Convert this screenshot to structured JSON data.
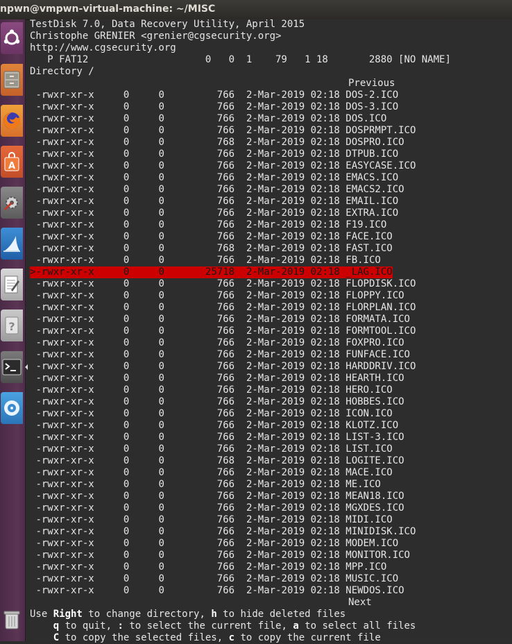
{
  "window": {
    "title": "npwn@vmpwn-virtual-machine: ~/MISC"
  },
  "launcher": {
    "items": [
      {
        "name": "ubuntu-dash"
      },
      {
        "name": "files"
      },
      {
        "name": "firefox"
      },
      {
        "name": "software-center"
      },
      {
        "name": "system-settings"
      },
      {
        "name": "wireshark"
      },
      {
        "name": "text-editor"
      },
      {
        "name": "help"
      },
      {
        "name": "terminal"
      },
      {
        "name": "disk-utility"
      },
      {
        "name": "trash"
      }
    ]
  },
  "terminal": {
    "header": [
      "TestDisk 7.0, Data Recovery Utility, April 2015",
      "Christophe GRENIER <grenier@cgsecurity.org>",
      "http://www.cgsecurity.org",
      "   P FAT12                    0   0  1    79   1 18       2880 [NO NAME]",
      "Directory /"
    ],
    "previous_label": "Previous",
    "next_label": "Next",
    "cursor_marker": ">",
    "files": [
      {
        "perm": "-rwxr-xr-x",
        "uid": "0",
        "gid": "0",
        "size": "766",
        "date": "2-Mar-2019",
        "time": "02:18",
        "name": "DOS-2.ICO"
      },
      {
        "perm": "-rwxr-xr-x",
        "uid": "0",
        "gid": "0",
        "size": "766",
        "date": "2-Mar-2019",
        "time": "02:18",
        "name": "DOS-3.ICO"
      },
      {
        "perm": "-rwxr-xr-x",
        "uid": "0",
        "gid": "0",
        "size": "766",
        "date": "2-Mar-2019",
        "time": "02:18",
        "name": "DOS.ICO"
      },
      {
        "perm": "-rwxr-xr-x",
        "uid": "0",
        "gid": "0",
        "size": "766",
        "date": "2-Mar-2019",
        "time": "02:18",
        "name": "DOSPRMPT.ICO"
      },
      {
        "perm": "-rwxr-xr-x",
        "uid": "0",
        "gid": "0",
        "size": "768",
        "date": "2-Mar-2019",
        "time": "02:18",
        "name": "DOSPRO.ICO"
      },
      {
        "perm": "-rwxr-xr-x",
        "uid": "0",
        "gid": "0",
        "size": "766",
        "date": "2-Mar-2019",
        "time": "02:18",
        "name": "DTPUB.ICO"
      },
      {
        "perm": "-rwxr-xr-x",
        "uid": "0",
        "gid": "0",
        "size": "766",
        "date": "2-Mar-2019",
        "time": "02:18",
        "name": "EASYCASE.ICO"
      },
      {
        "perm": "-rwxr-xr-x",
        "uid": "0",
        "gid": "0",
        "size": "766",
        "date": "2-Mar-2019",
        "time": "02:18",
        "name": "EMACS.ICO"
      },
      {
        "perm": "-rwxr-xr-x",
        "uid": "0",
        "gid": "0",
        "size": "766",
        "date": "2-Mar-2019",
        "time": "02:18",
        "name": "EMACS2.ICO"
      },
      {
        "perm": "-rwxr-xr-x",
        "uid": "0",
        "gid": "0",
        "size": "766",
        "date": "2-Mar-2019",
        "time": "02:18",
        "name": "EMAIL.ICO"
      },
      {
        "perm": "-rwxr-xr-x",
        "uid": "0",
        "gid": "0",
        "size": "766",
        "date": "2-Mar-2019",
        "time": "02:18",
        "name": "EXTRA.ICO"
      },
      {
        "perm": "-rwxr-xr-x",
        "uid": "0",
        "gid": "0",
        "size": "766",
        "date": "2-Mar-2019",
        "time": "02:18",
        "name": "F19.ICO"
      },
      {
        "perm": "-rwxr-xr-x",
        "uid": "0",
        "gid": "0",
        "size": "766",
        "date": "2-Mar-2019",
        "time": "02:18",
        "name": "FACE.ICO"
      },
      {
        "perm": "-rwxr-xr-x",
        "uid": "0",
        "gid": "0",
        "size": "768",
        "date": "2-Mar-2019",
        "time": "02:18",
        "name": "FAST.ICO"
      },
      {
        "perm": "-rwxr-xr-x",
        "uid": "0",
        "gid": "0",
        "size": "766",
        "date": "2-Mar-2019",
        "time": "02:18",
        "name": "FB.ICO"
      },
      {
        "perm": "-rwxr-xr-x",
        "uid": "0",
        "gid": "0",
        "size": "25718",
        "date": "2-Mar-2019",
        "time": "02:18",
        "name": "_LAG.ICO",
        "selected": true
      },
      {
        "perm": "-rwxr-xr-x",
        "uid": "0",
        "gid": "0",
        "size": "766",
        "date": "2-Mar-2019",
        "time": "02:18",
        "name": "FLOPDISK.ICO"
      },
      {
        "perm": "-rwxr-xr-x",
        "uid": "0",
        "gid": "0",
        "size": "766",
        "date": "2-Mar-2019",
        "time": "02:18",
        "name": "FLOPPY.ICO"
      },
      {
        "perm": "-rwxr-xr-x",
        "uid": "0",
        "gid": "0",
        "size": "766",
        "date": "2-Mar-2019",
        "time": "02:18",
        "name": "FLORPLAN.ICO"
      },
      {
        "perm": "-rwxr-xr-x",
        "uid": "0",
        "gid": "0",
        "size": "766",
        "date": "2-Mar-2019",
        "time": "02:18",
        "name": "FORMATA.ICO"
      },
      {
        "perm": "-rwxr-xr-x",
        "uid": "0",
        "gid": "0",
        "size": "766",
        "date": "2-Mar-2019",
        "time": "02:18",
        "name": "FORMTOOL.ICO"
      },
      {
        "perm": "-rwxr-xr-x",
        "uid": "0",
        "gid": "0",
        "size": "766",
        "date": "2-Mar-2019",
        "time": "02:18",
        "name": "FOXPRO.ICO"
      },
      {
        "perm": "-rwxr-xr-x",
        "uid": "0",
        "gid": "0",
        "size": "766",
        "date": "2-Mar-2019",
        "time": "02:18",
        "name": "FUNFACE.ICO"
      },
      {
        "perm": "-rwxr-xr-x",
        "uid": "0",
        "gid": "0",
        "size": "766",
        "date": "2-Mar-2019",
        "time": "02:18",
        "name": "HARDDRIV.ICO"
      },
      {
        "perm": "-rwxr-xr-x",
        "uid": "0",
        "gid": "0",
        "size": "766",
        "date": "2-Mar-2019",
        "time": "02:18",
        "name": "HEARTH.ICO"
      },
      {
        "perm": "-rwxr-xr-x",
        "uid": "0",
        "gid": "0",
        "size": "766",
        "date": "2-Mar-2019",
        "time": "02:18",
        "name": "HERO.ICO"
      },
      {
        "perm": "-rwxr-xr-x",
        "uid": "0",
        "gid": "0",
        "size": "766",
        "date": "2-Mar-2019",
        "time": "02:18",
        "name": "HOBBES.ICO"
      },
      {
        "perm": "-rwxr-xr-x",
        "uid": "0",
        "gid": "0",
        "size": "766",
        "date": "2-Mar-2019",
        "time": "02:18",
        "name": "ICON.ICO"
      },
      {
        "perm": "-rwxr-xr-x",
        "uid": "0",
        "gid": "0",
        "size": "766",
        "date": "2-Mar-2019",
        "time": "02:18",
        "name": "KLOTZ.ICO"
      },
      {
        "perm": "-rwxr-xr-x",
        "uid": "0",
        "gid": "0",
        "size": "766",
        "date": "2-Mar-2019",
        "time": "02:18",
        "name": "LIST-3.ICO"
      },
      {
        "perm": "-rwxr-xr-x",
        "uid": "0",
        "gid": "0",
        "size": "766",
        "date": "2-Mar-2019",
        "time": "02:18",
        "name": "LIST.ICO"
      },
      {
        "perm": "-rwxr-xr-x",
        "uid": "0",
        "gid": "0",
        "size": "768",
        "date": "2-Mar-2019",
        "time": "02:18",
        "name": "LOGITE.ICO"
      },
      {
        "perm": "-rwxr-xr-x",
        "uid": "0",
        "gid": "0",
        "size": "766",
        "date": "2-Mar-2019",
        "time": "02:18",
        "name": "MACE.ICO"
      },
      {
        "perm": "-rwxr-xr-x",
        "uid": "0",
        "gid": "0",
        "size": "766",
        "date": "2-Mar-2019",
        "time": "02:18",
        "name": "ME.ICO"
      },
      {
        "perm": "-rwxr-xr-x",
        "uid": "0",
        "gid": "0",
        "size": "766",
        "date": "2-Mar-2019",
        "time": "02:18",
        "name": "MEAN18.ICO"
      },
      {
        "perm": "-rwxr-xr-x",
        "uid": "0",
        "gid": "0",
        "size": "766",
        "date": "2-Mar-2019",
        "time": "02:18",
        "name": "MGXDES.ICO"
      },
      {
        "perm": "-rwxr-xr-x",
        "uid": "0",
        "gid": "0",
        "size": "766",
        "date": "2-Mar-2019",
        "time": "02:18",
        "name": "MIDI.ICO"
      },
      {
        "perm": "-rwxr-xr-x",
        "uid": "0",
        "gid": "0",
        "size": "766",
        "date": "2-Mar-2019",
        "time": "02:18",
        "name": "MINIDISK.ICO"
      },
      {
        "perm": "-rwxr-xr-x",
        "uid": "0",
        "gid": "0",
        "size": "766",
        "date": "2-Mar-2019",
        "time": "02:18",
        "name": "MODEM.ICO"
      },
      {
        "perm": "-rwxr-xr-x",
        "uid": "0",
        "gid": "0",
        "size": "766",
        "date": "2-Mar-2019",
        "time": "02:18",
        "name": "MONITOR.ICO"
      },
      {
        "perm": "-rwxr-xr-x",
        "uid": "0",
        "gid": "0",
        "size": "766",
        "date": "2-Mar-2019",
        "time": "02:18",
        "name": "MPP.ICO"
      },
      {
        "perm": "-rwxr-xr-x",
        "uid": "0",
        "gid": "0",
        "size": "766",
        "date": "2-Mar-2019",
        "time": "02:18",
        "name": "MUSIC.ICO"
      },
      {
        "perm": "-rwxr-xr-x",
        "uid": "0",
        "gid": "0",
        "size": "766",
        "date": "2-Mar-2019",
        "time": "02:18",
        "name": "NEWDOS.ICO"
      }
    ],
    "help": {
      "line1_prefix": "Use ",
      "line1_key1": "Right",
      "line1_mid": " to change directory, ",
      "line1_key2": "h",
      "line1_suffix": " to hide deleted files",
      "line2_pad": "    ",
      "line2_key1": "q",
      "line2_t1": " to quit, ",
      "line2_key2": ":",
      "line2_t2": " to select the current file, ",
      "line2_key3": "a",
      "line2_t3": " to select all files",
      "line3_pad": "    ",
      "line3_key1": "C",
      "line3_t1": " to copy the selected files, ",
      "line3_key2": "c",
      "line3_t2": " to copy the current file"
    }
  }
}
